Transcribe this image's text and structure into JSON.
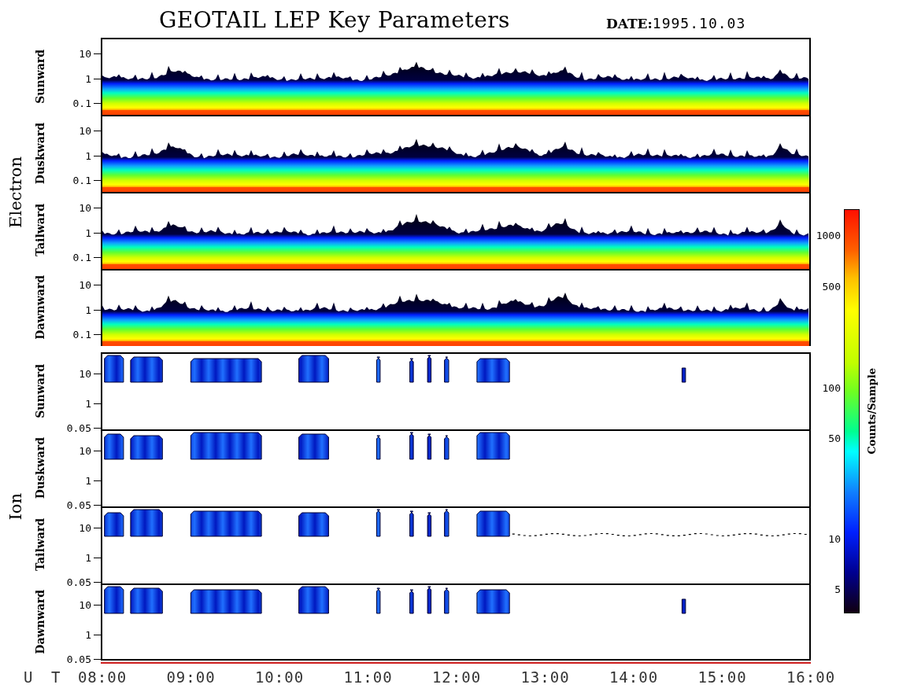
{
  "title": "GEOTAIL LEP Key Parameters",
  "date": {
    "label": "DATE:",
    "value": "1995.10.03"
  },
  "groups": [
    {
      "name": "Electron",
      "kind": "electron",
      "panels": [
        {
          "label": "Sunward",
          "y_ticks": [
            "10",
            "1",
            "0.1"
          ]
        },
        {
          "label": "Duskward",
          "y_ticks": [
            "10",
            "1",
            "0.1"
          ]
        },
        {
          "label": "Tailward",
          "y_ticks": [
            "10",
            "1",
            "0.1"
          ]
        },
        {
          "label": "Dawnward",
          "y_ticks": [
            "10",
            "1",
            "0.1"
          ]
        }
      ]
    },
    {
      "name": "Ion",
      "kind": "ion",
      "panels": [
        {
          "label": "Sunward",
          "y_ticks": [
            "10",
            "1",
            "0.05"
          ]
        },
        {
          "label": "Duskward",
          "y_ticks": [
            "10",
            "1",
            "0.05"
          ]
        },
        {
          "label": "Tailward",
          "y_ticks": [
            "10",
            "1",
            "0.05"
          ]
        },
        {
          "label": "Dawnward",
          "y_ticks": [
            "10",
            "1",
            "0.05"
          ]
        }
      ]
    }
  ],
  "x_axis": {
    "label": "U T",
    "ticks": [
      "08:00",
      "09:00",
      "10:00",
      "11:00",
      "12:00",
      "13:00",
      "14:00",
      "15:00",
      "16:00"
    ]
  },
  "colorbar": {
    "label": "Counts/Sample",
    "ticks": [
      "1000",
      "500",
      "100",
      "50",
      "10",
      "5"
    ]
  }
}
